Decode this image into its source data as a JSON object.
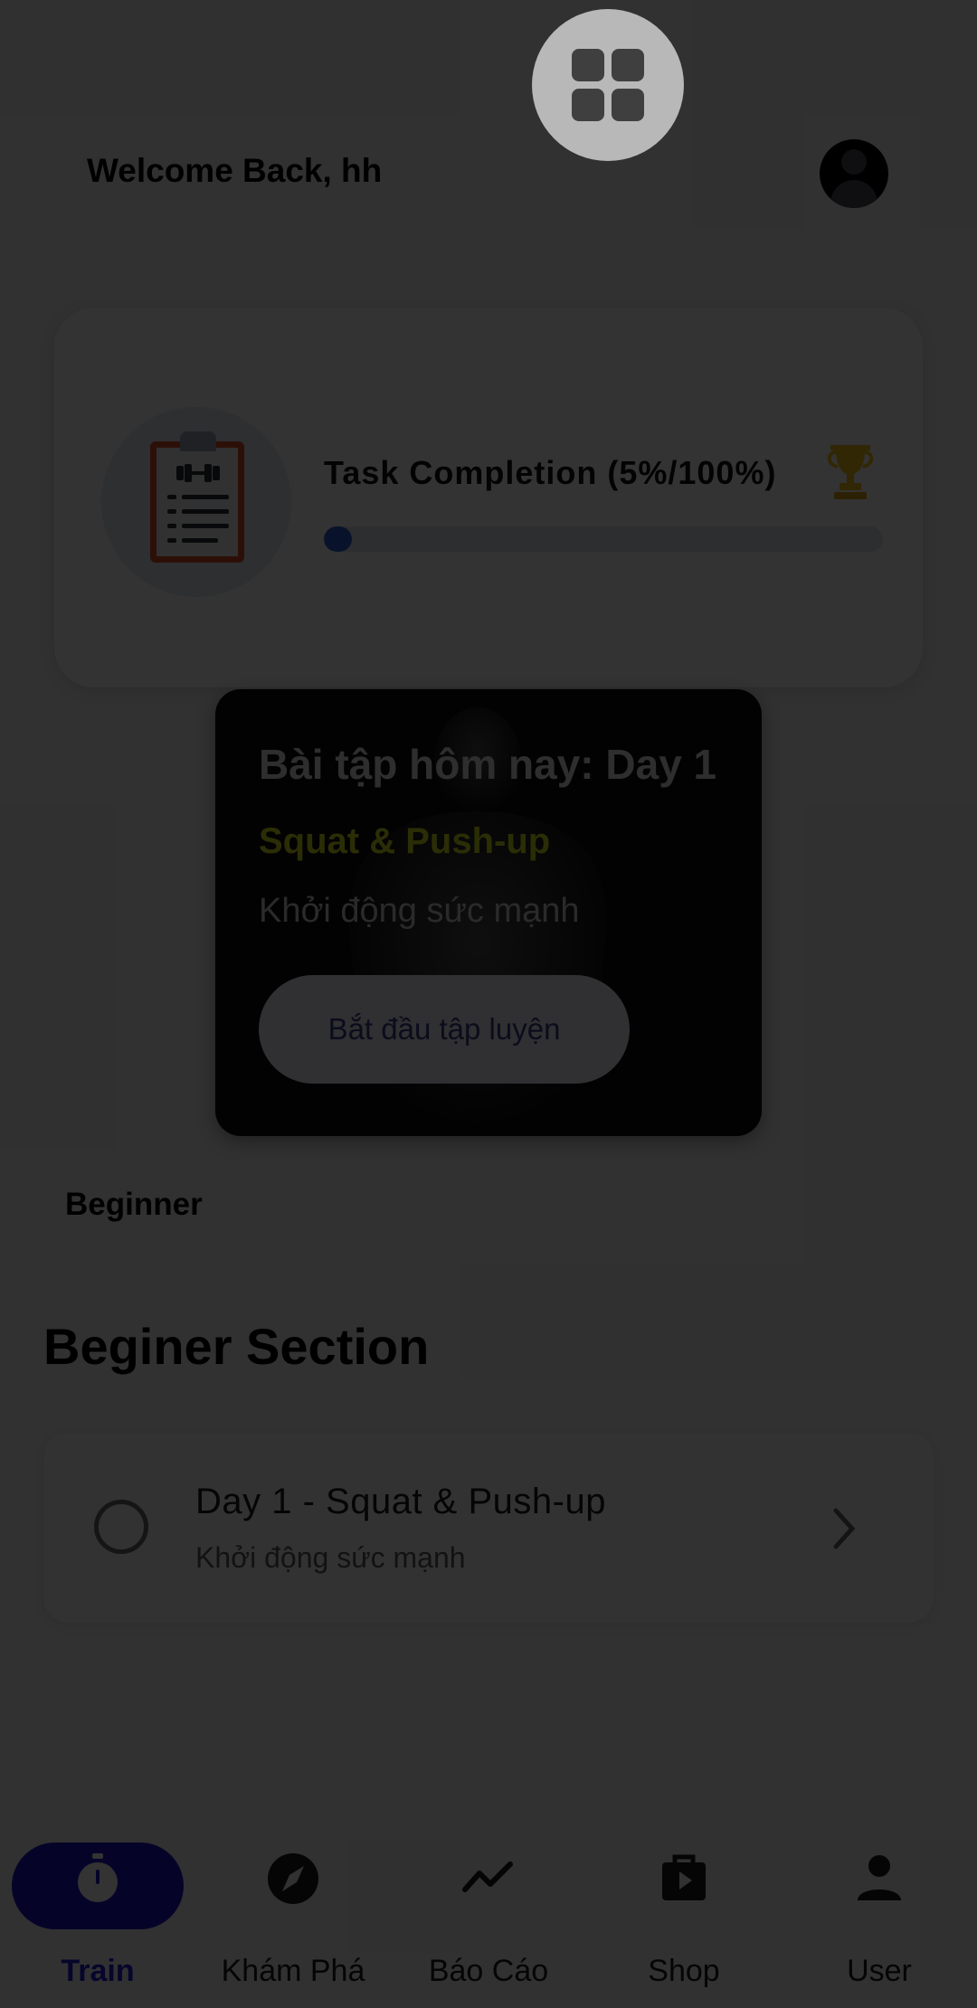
{
  "header": {
    "welcome_text": "Welcome Back, hh"
  },
  "task_card": {
    "title": "Task Completion (5%/100%)",
    "progress_percent": 5
  },
  "workout_card": {
    "heading": "Bài tập hôm nay: Day 1",
    "name": "Squat & Push-up",
    "subtitle": "Khởi động sức mạnh",
    "start_button": "Bắt đầu tập luyện"
  },
  "level_label": "Beginner",
  "section": {
    "title": "Beginer Section",
    "days": [
      {
        "title": "Day 1 - Squat & Push-up",
        "subtitle": "Khởi động sức mạnh"
      }
    ]
  },
  "bottom_nav": {
    "items": [
      {
        "label": "Train",
        "icon": "stopwatch-icon",
        "active": true
      },
      {
        "label": "Khám Phá",
        "icon": "compass-icon",
        "active": false
      },
      {
        "label": "Báo Cáo",
        "icon": "trend-line-icon",
        "active": false
      },
      {
        "label": "Shop",
        "icon": "shopping-bag-icon",
        "active": false
      },
      {
        "label": "User",
        "icon": "person-icon",
        "active": false
      }
    ]
  },
  "colors": {
    "accent": "#1b18c8",
    "workout_name": "#d6e020",
    "progress": "#2a5fd6",
    "trophy": "#f2c21a"
  }
}
